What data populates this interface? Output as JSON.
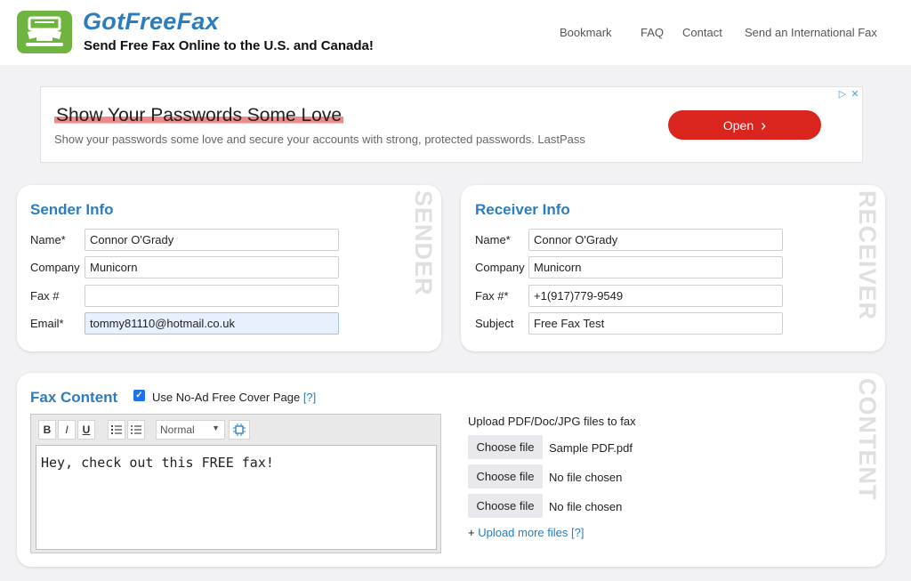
{
  "header": {
    "brand": "GotFreeFax",
    "tagline": "Send Free Fax Online to the U.S. and Canada!",
    "nav": [
      "Bookmark",
      "FAQ",
      "Contact",
      "Send an International Fax"
    ]
  },
  "ad": {
    "title": "Show Your Passwords Some Love",
    "text": "Show your passwords some love and secure your accounts with strong, protected passwords. LastPass",
    "button": "Open",
    "chevron": "›"
  },
  "sender": {
    "title": "Sender Info",
    "vertical": "SENDER",
    "fields": [
      {
        "label": "Name*",
        "value": "Connor O'Grady"
      },
      {
        "label": "Company",
        "value": "Municorn"
      },
      {
        "label": "Fax #",
        "value": ""
      },
      {
        "label": "Email*",
        "value": "tommy81110@hotmail.co.uk"
      }
    ]
  },
  "receiver": {
    "title": "Receiver Info",
    "vertical": "RECEIVER",
    "fields": [
      {
        "label": "Name*",
        "value": "Connor O'Grady"
      },
      {
        "label": "Company",
        "value": "Municorn"
      },
      {
        "label": "Fax #*",
        "value": "+1(917)779-9549"
      },
      {
        "label": "Subject",
        "value": "Free Fax Test"
      }
    ]
  },
  "content": {
    "title": "Fax Content",
    "vertical": "CONTENT",
    "cover_label": "Use No-Ad Free Cover Page",
    "help": "[?]",
    "toolbar": {
      "bold": "B",
      "italic": "I",
      "underline": "U",
      "format": "Normal"
    },
    "body": "Hey, check out this FREE fax!",
    "upload_label": "Upload PDF/Doc/JPG files to fax",
    "choose_label": "Choose file",
    "files": [
      "Sample PDF.pdf",
      "No file chosen",
      "No file chosen"
    ],
    "more_prefix": "+ ",
    "more_link": "Upload more files",
    "more_help": "[?]"
  },
  "colors": {
    "brand": "#2c7dbf",
    "logo": "#6fb340",
    "ad_button": "#d9251d"
  }
}
